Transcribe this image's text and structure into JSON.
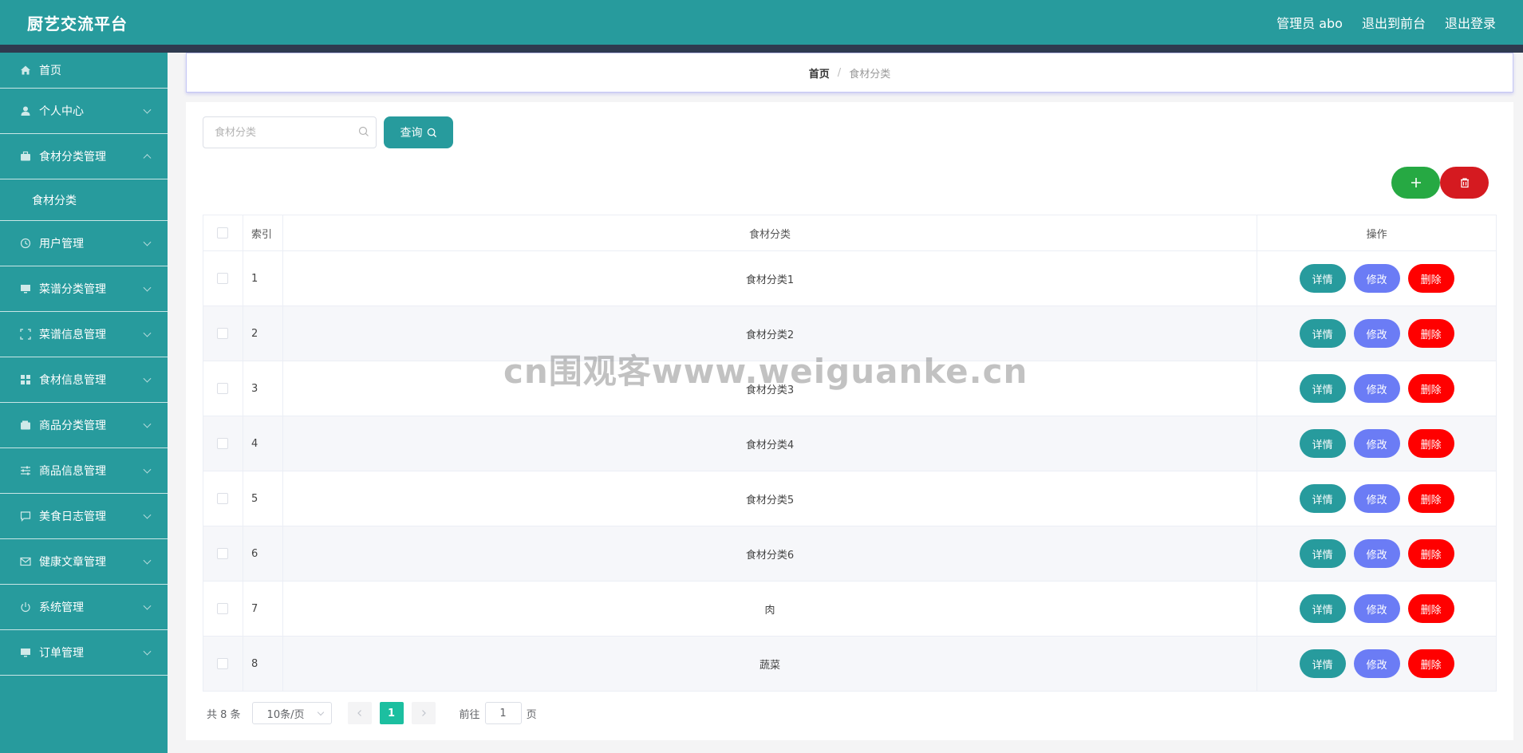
{
  "header": {
    "title": "厨艺交流平台",
    "admin": "管理员 abo",
    "to_front": "退出到前台",
    "logout": "退出登录"
  },
  "sidebar": {
    "items": [
      {
        "label": "首页",
        "icon": "home-icon"
      },
      {
        "label": "个人中心",
        "icon": "user-icon"
      },
      {
        "label": "食材分类管理",
        "icon": "briefcase-icon",
        "expanded": true,
        "children": [
          {
            "label": "食材分类"
          }
        ]
      },
      {
        "label": "用户管理",
        "icon": "clock-icon"
      },
      {
        "label": "菜谱分类管理",
        "icon": "monitor-icon"
      },
      {
        "label": "菜谱信息管理",
        "icon": "fullscreen-icon"
      },
      {
        "label": "食材信息管理",
        "icon": "grid-icon"
      },
      {
        "label": "商品分类管理",
        "icon": "wallet-icon"
      },
      {
        "label": "商品信息管理",
        "icon": "sliders-icon"
      },
      {
        "label": "美食日志管理",
        "icon": "chat-icon"
      },
      {
        "label": "健康文章管理",
        "icon": "mail-icon"
      },
      {
        "label": "系统管理",
        "icon": "power-icon"
      },
      {
        "label": "订单管理",
        "icon": "monitor-icon"
      }
    ]
  },
  "breadcrumb": {
    "home": "首页",
    "separator": "/",
    "current": "食材分类"
  },
  "search": {
    "placeholder": "食材分类",
    "value": "",
    "button": "查询"
  },
  "table": {
    "headers": {
      "index": "索引",
      "name": "食材分类",
      "ops": "操作"
    },
    "rows": [
      {
        "index": "1",
        "name": "食材分类1"
      },
      {
        "index": "2",
        "name": "食材分类2"
      },
      {
        "index": "3",
        "name": "食材分类3"
      },
      {
        "index": "4",
        "name": "食材分类4"
      },
      {
        "index": "5",
        "name": "食材分类5"
      },
      {
        "index": "6",
        "name": "食材分类6"
      },
      {
        "index": "7",
        "name": "肉"
      },
      {
        "index": "8",
        "name": "蔬菜"
      }
    ],
    "ops": {
      "detail": "详情",
      "edit": "修改",
      "delete": "删除"
    }
  },
  "pagination": {
    "total": "共 8 条",
    "page_size": "10条/页",
    "current_page": "1",
    "goto": "前往",
    "goto_value": "1",
    "page_unit": "页"
  },
  "watermark": "cn围观客www.weiguanke.cn",
  "colors": {
    "primary": "#279b9d",
    "add": "#26a943",
    "delete_bulk": "#d51a20",
    "edit": "#6b7cf5",
    "delete": "#ff0000",
    "page_active": "#1cbfa0"
  }
}
